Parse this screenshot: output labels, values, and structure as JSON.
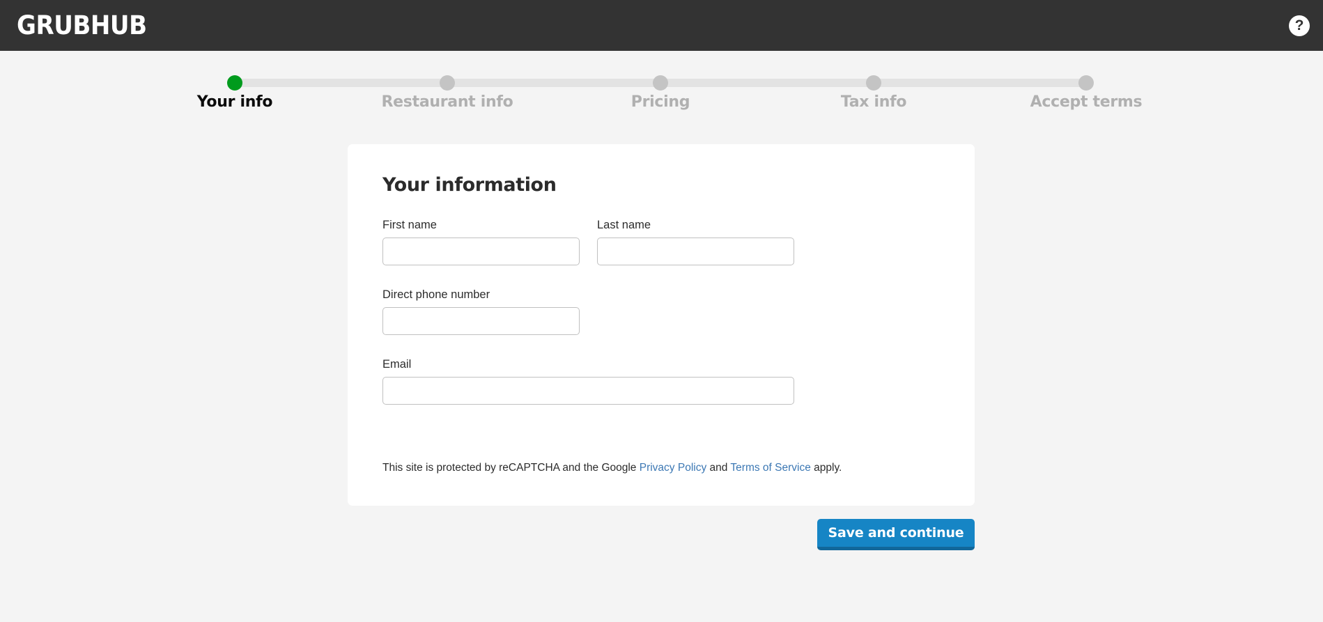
{
  "header": {
    "brand": "GRUBHUB",
    "help_icon": "question-mark-circle-icon",
    "help_glyph": "?",
    "background_color": "#333333"
  },
  "stepper": {
    "active_color": "#009b1d",
    "inactive_color": "#c4c4c4",
    "track_color": "#e3e3e3",
    "current_step_index": 0,
    "steps": [
      {
        "label": "Your info",
        "active": true
      },
      {
        "label": "Restaurant info",
        "active": false
      },
      {
        "label": "Pricing",
        "active": false
      },
      {
        "label": "Tax info",
        "active": false
      },
      {
        "label": "Accept terms",
        "active": false
      }
    ]
  },
  "card": {
    "title": "Your information",
    "fields": [
      {
        "label": "First name",
        "value": "",
        "placeholder": ""
      },
      {
        "label": "Last name",
        "value": "",
        "placeholder": ""
      },
      {
        "label": "Direct phone number",
        "value": "",
        "placeholder": ""
      },
      {
        "label": "Email",
        "value": "",
        "placeholder": ""
      }
    ],
    "recaptcha": {
      "text_before": "This site is protected by reCAPTCHA and the Google ",
      "privacy_link": "Privacy Policy",
      "text_middle": " and ",
      "terms_link": "Terms of Service",
      "text_after": " apply.",
      "link_color": "#3c78b4"
    }
  },
  "footer": {
    "submit_label": "Save and continue",
    "submit_color": "#1685c5",
    "submit_shadow_color": "#11679a"
  }
}
